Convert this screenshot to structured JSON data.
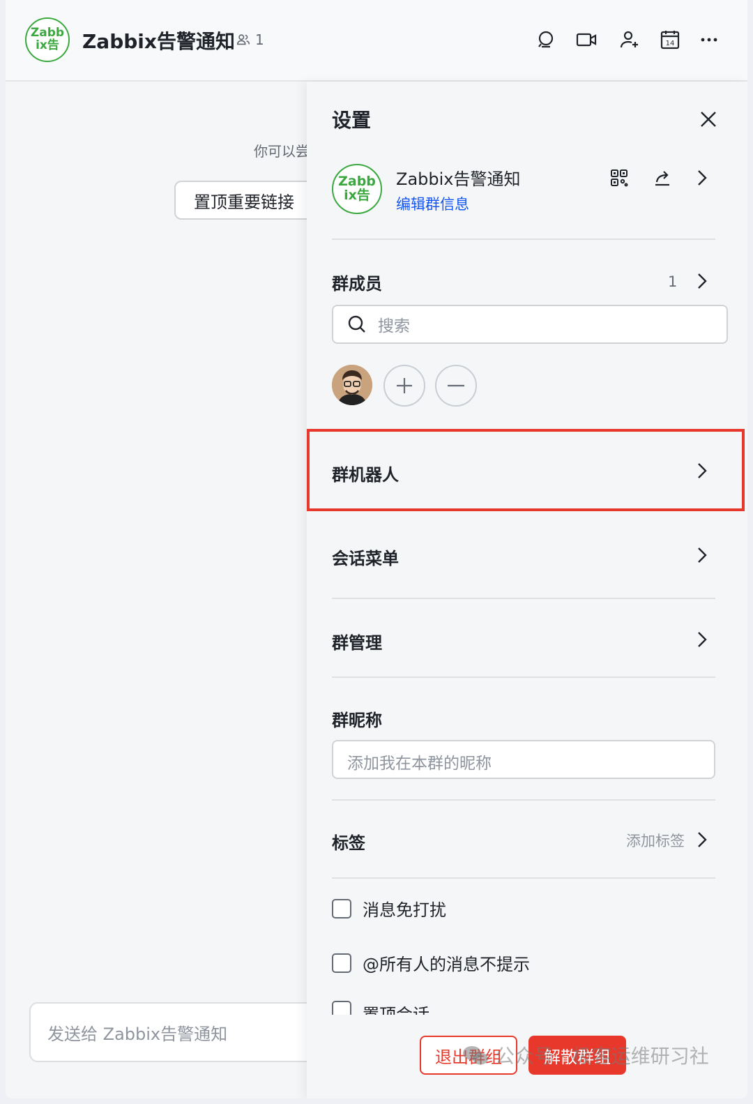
{
  "header": {
    "avatar_text": "Zabb ix告",
    "title": "Zabbix告警通知",
    "member_count": "1",
    "icons": [
      "search-icon",
      "video-icon",
      "add-member-icon",
      "calendar-icon",
      "more-icon"
    ],
    "calendar_day": "14"
  },
  "chat": {
    "hint": "你可以尝",
    "pin_link_label": "置顶重要链接",
    "compose_placeholder": "发送给 Zabbix告警通知"
  },
  "settings": {
    "title": "设置",
    "group": {
      "avatar_text": "Zabb ix告",
      "name": "Zabbix告警通知",
      "edit_label": "编辑群信息"
    },
    "members": {
      "title": "群成员",
      "count": "1",
      "search_placeholder": "搜索"
    },
    "menu": {
      "bots": "群机器人",
      "session_menu": "会话菜单",
      "group_manage": "群管理"
    },
    "nickname": {
      "title": "群昵称",
      "placeholder": "添加我在本群的昵称"
    },
    "tags": {
      "title": "标签",
      "add_label": "添加标签"
    },
    "options": {
      "mute": "消息免打扰",
      "at_all_silent": "@所有人的消息不提示",
      "pin_chat": "置顶会话"
    },
    "buttons": {
      "leave": "退出群组",
      "disband": "解散群组"
    }
  },
  "watermark": "公众号 · 极客运维研习社",
  "colors": {
    "accent_blue": "#1456f0",
    "danger_red": "#e8382c",
    "avatar_green": "#3aa83e"
  }
}
